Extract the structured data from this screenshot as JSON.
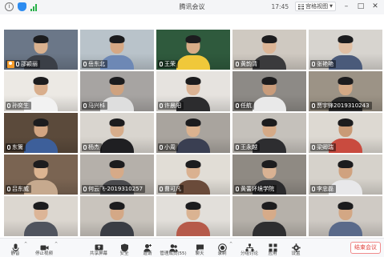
{
  "window": {
    "title": "腾讯会议",
    "time": "17:45",
    "view_label": "宫格视图"
  },
  "participants": [
    {
      "name": "邵颖丽",
      "host": true,
      "bg": "#6b7788",
      "shirt": "#3b3f47",
      "skin": "#d9b18f"
    },
    {
      "name": "岳东北",
      "host": false,
      "bg": "#b9c3ca",
      "shirt": "#6d88b5",
      "skin": "#d6a884"
    },
    {
      "name": "王荣",
      "host": false,
      "bg": "#2f5a3d",
      "shirt": "#f0c83a",
      "skin": "#d8ad88"
    },
    {
      "name": "黄韵清",
      "host": false,
      "bg": "#cfc9c1",
      "shirt": "#3a3a3c",
      "skin": "#dcb596"
    },
    {
      "name": "张艳艳",
      "host": false,
      "bg": "#d7d4cf",
      "shirt": "#4a5a7a",
      "skin": "#e1bfa3"
    },
    {
      "name": "孙奕生",
      "host": false,
      "bg": "#ece9e4",
      "shirt": "#f2f2f2",
      "skin": "#d9ae8c"
    },
    {
      "name": "马兴科",
      "host": false,
      "bg": "#a7a4a2",
      "shirt": "#dedede",
      "skin": "#cfa27f"
    },
    {
      "name": "许晨阳",
      "host": false,
      "bg": "#e6e3df",
      "shirt": "#2c2c2e",
      "skin": "#dbb394"
    },
    {
      "name": "任航",
      "host": false,
      "bg": "#8d8a86",
      "shirt": "#e9e9e9",
      "skin": "#c99c7b"
    },
    {
      "name": "贾宇锋2019310243",
      "host": false,
      "bg": "#9c9386",
      "shirt": "#2a2a2a",
      "skin": "#d4a985"
    },
    {
      "name": "东篱",
      "host": false,
      "bg": "#5b4a3b",
      "shirt": "#3d5f9a",
      "skin": "#d2a582"
    },
    {
      "name": "杨杰",
      "host": false,
      "bg": "#d9d5cf",
      "shirt": "#1f1f22",
      "skin": "#d7ad8b"
    },
    {
      "name": "小周",
      "host": false,
      "bg": "#a9a49e",
      "shirt": "#3a3f52",
      "skin": "#dbb28f"
    },
    {
      "name": "王永越",
      "host": false,
      "bg": "#c5c1bb",
      "shirt": "#2d2d30",
      "skin": "#d5aa87"
    },
    {
      "name": "梁卿瑞",
      "host": false,
      "bg": "#ddd9d2",
      "shirt": "#c94b3f",
      "skin": "#c99a76"
    },
    {
      "name": "吕东威",
      "host": false,
      "bg": "#7a6452",
      "shirt": "#c6a98e",
      "skin": "#dcb491"
    },
    {
      "name": "何云飞-2019310257",
      "host": false,
      "bg": "#b5b0aa",
      "shirt": "#4b4b4e",
      "skin": "#d6aa88"
    },
    {
      "name": "曹可凡",
      "host": false,
      "bg": "#e1ddd6",
      "shirt": "#6a4b3a",
      "skin": "#dab190"
    },
    {
      "name": "黄蕾环境学院",
      "host": false,
      "bg": "#8f8a83",
      "shirt": "#2a2a2c",
      "skin": "#d9b293"
    },
    {
      "name": "李忠磊",
      "host": false,
      "bg": "#d6d2cb",
      "shirt": "#e8e8ea",
      "skin": "#d0a27f"
    },
    {
      "name": "",
      "host": false,
      "bg": "#dcd7d0",
      "shirt": "#50545e",
      "skin": "#dcb597"
    },
    {
      "name": "",
      "host": false,
      "bg": "#c9c4bd",
      "shirt": "#3a3d44",
      "skin": "#d4a886"
    },
    {
      "name": "",
      "host": false,
      "bg": "#e2dfda",
      "shirt": "#b65a4a",
      "skin": "#dab392"
    },
    {
      "name": "",
      "host": false,
      "bg": "#b6b1aa",
      "shirt": "#2e2e30",
      "skin": "#d6ab89"
    },
    {
      "name": "",
      "host": false,
      "bg": "#cfcac4",
      "shirt": "#5a6a8a",
      "skin": "#d3a784"
    }
  ],
  "toolbar": {
    "mute": "静音",
    "stop_video": "停止视频",
    "share": "共享屏幕",
    "security": "安全",
    "invite": "邀请",
    "members": "管理成员(55)",
    "chat": "聊天",
    "record": "录制",
    "breakout": "分组讨论",
    "apps": "应用",
    "settings": "设置",
    "end": "结束会议"
  },
  "colors": {
    "accent": "#2d8cf0",
    "end": "#e0433f",
    "host": "#f39b2b"
  }
}
